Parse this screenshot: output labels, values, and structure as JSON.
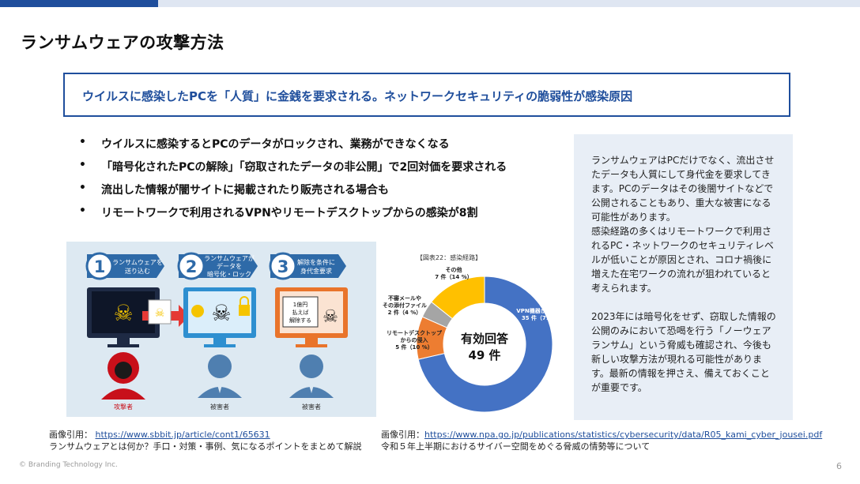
{
  "title": "ランサムウェアの攻撃方法",
  "banner": "ウイルスに感染したPCを「人質」に金銭を要求される。ネットワークセキュリティの脆弱性が感染原因",
  "bullet_marker": "•",
  "bullets": [
    "ウイルスに感染するとPCのデータがロックされ、業務ができなくなる",
    "「暗号化されたPCの解除」「窃取されたデータの非公開」で2回対価を要求される",
    "流出した情報が闇サイトに掲載されたり販売される場合も",
    "リモートワークで利用されるVPNやリモートデスクトップからの感染が8割"
  ],
  "side_text": [
    "ランサムウェアはPCだけでなく、流出させたデータも人質にして身代金を要求してきます。PCのデータはその後闇サイトなどで公開されることもあり、重大な被害になる可能性があります。",
    "感染経路の多くはリモートワークで利用されるPC・ネットワークのセキュリティレベルが低いことが原因とされ、コロナ禍後に増えた在宅ワークの流れが狙われていると考えられます。",
    "2023年には暗号化をせず、窃取した情報の公開のみにおいて恐喝を行う「ノーウェアランサム」という脅威も確認され、今後も新しい攻撃方法が現れる可能性があります。最新の情報を押さえ、備えておくことが重要です。"
  ],
  "steps": [
    {
      "num": "1",
      "line1": "ランサムウェアを",
      "line2": "送り込む",
      "line3": ""
    },
    {
      "num": "2",
      "line1": "ランサムウェアが",
      "line2": "データを",
      "line3": "暗号化・ロック"
    },
    {
      "num": "3",
      "line1": "解除を条件に",
      "line2": "身代金要求",
      "line3": ""
    }
  ],
  "ransom_note": [
    "1億円",
    "払えば",
    "解除する"
  ],
  "persons": [
    "攻撃者",
    "被害者",
    "被害者"
  ],
  "colors": {
    "brand": "#1f4e9c",
    "step_blue": "#2e6aa8",
    "attacker": "#c8101a",
    "victim": "#4f7fb0",
    "panel": "#e8eef6"
  },
  "chart_data": {
    "type": "pie",
    "donut": true,
    "title": "【図表22：感染経路】",
    "center_label": "有効回答",
    "center_value": "49 件",
    "slices": [
      {
        "label_lines": [
          "VPN機器からの侵入",
          "35 件（71 %）"
        ],
        "value": 35,
        "percent": 71,
        "color": "#4472c4"
      },
      {
        "label_lines": [
          "リモートデスクトップ",
          "からの侵入",
          "5 件（10 %）"
        ],
        "value": 5,
        "percent": 10,
        "color": "#ed7d31"
      },
      {
        "label_lines": [
          "不審メールや",
          "その添付ファイル",
          "2 件（4 %）"
        ],
        "value": 2,
        "percent": 4,
        "color": "#a5a5a5"
      },
      {
        "label_lines": [
          "その他",
          "7 件（14 %）"
        ],
        "value": 7,
        "percent": 14,
        "color": "#ffc000"
      }
    ]
  },
  "captions": {
    "left": {
      "prefix": "画像引用：",
      "url": "https://www.sbbit.jp/article/cont1/65631",
      "desc": "ランサムウェアとは何か？手口・対策・事例、気になるポイントをまとめて解説"
    },
    "right": {
      "prefix": "画像引用：",
      "url": "https://www.npa.go.jp/publications/statistics/cybersecurity/data/R05_kami_cyber_jousei.pdf",
      "desc": "令和５年上半期におけるサイバー空間をめぐる脅威の情勢等について"
    }
  },
  "footer": "© Branding Technology Inc.",
  "page_number": "6"
}
